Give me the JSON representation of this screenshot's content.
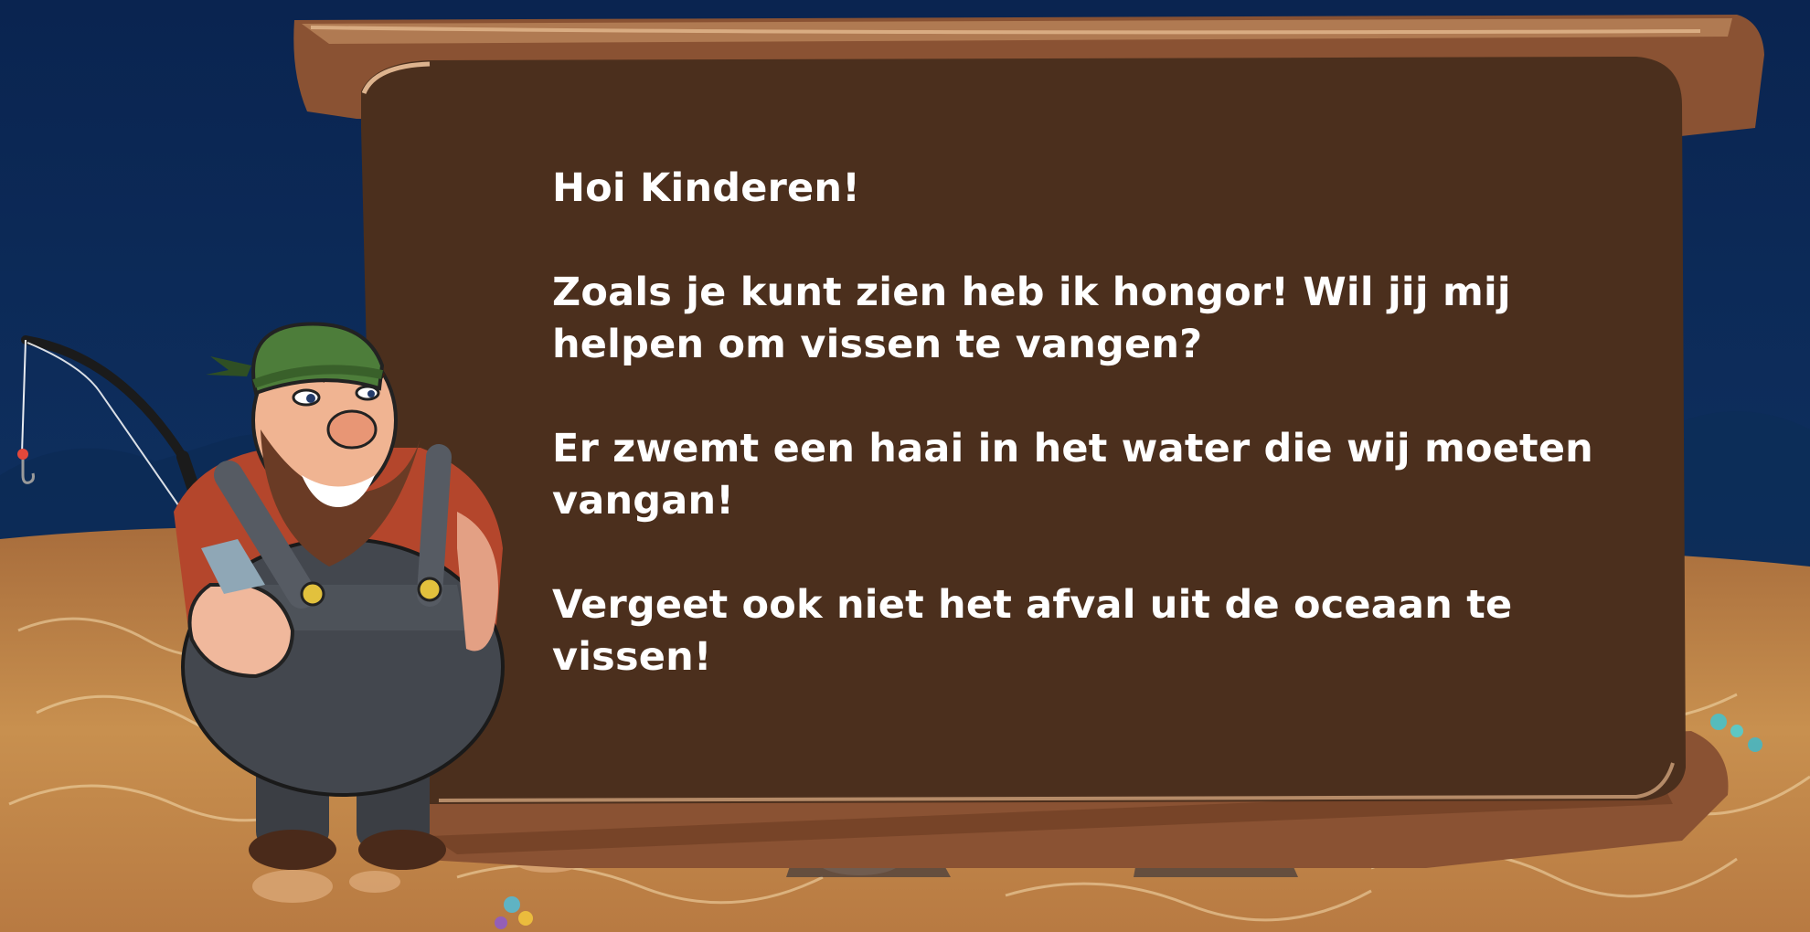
{
  "dialog": {
    "greeting": "Hoi Kinderen!",
    "line1": "Zoals je kunt zien heb ik hongor! Wil jij mij helpen om vissen te vangen?",
    "line2": "Er zwemt een haai in het water die wij moeten vangan!",
    "line3": "Vergeet ook niet het afval uit de oceaan te vissen!"
  },
  "colors": {
    "board_fill": "#4b2f1d",
    "board_frame": "#8a5233",
    "ocean_deep": "#0b2550",
    "sand": "#c8904f",
    "text": "#ffffff"
  }
}
